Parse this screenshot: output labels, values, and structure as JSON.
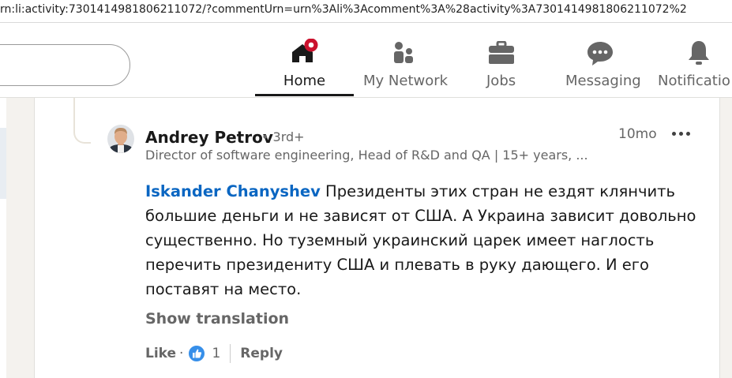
{
  "browser": {
    "url": "rn:li:activity:7301414981806211072/?commentUrn=urn%3Ali%3Acomment%3A%28activity%3A7301414981806211072%2"
  },
  "nav": {
    "items": [
      {
        "label": "Home",
        "icon": "home-icon",
        "active": true
      },
      {
        "label": "My Network",
        "icon": "network-icon"
      },
      {
        "label": "Jobs",
        "icon": "briefcase-icon"
      },
      {
        "label": "Messaging",
        "icon": "messaging-icon"
      },
      {
        "label": "Notificatio",
        "icon": "bell-icon"
      }
    ]
  },
  "comment": {
    "author": "Andrey Petrov",
    "degree": "• 3rd+",
    "headline": "Director of software engineering, Head of R&D and QA | 15+ years, ...",
    "time": "10mo",
    "mention": "Iskander Chanyshev",
    "text": "Президенты этих стран не ездят клянчить большие деньги и не зависят от США. А Украина зависит довольно существенно. Но туземный украинский царек имеет наглость перечить президениту США и плевать в руку дающего. И его поставят на место.",
    "show_translation": "Show translation",
    "like_label": "Like",
    "separator": "·",
    "reaction_count": "1",
    "reply_label": "Reply"
  },
  "colors": {
    "link": "#0a66c2",
    "notification_badge": "#cb112d",
    "reaction_like": "#378fe9"
  }
}
